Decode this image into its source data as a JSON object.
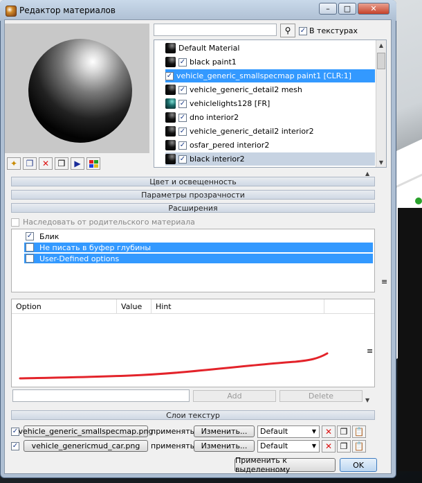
{
  "window": {
    "title": "Редактор материалов"
  },
  "titlebar": {
    "minimize": "–",
    "maximize": "□",
    "close": "✕"
  },
  "search": {
    "value": "",
    "in_textures_label": "В текстурах",
    "in_textures_checked": true
  },
  "materials": [
    {
      "name": "Default Material",
      "checked": null,
      "state": "normal",
      "swatch": "black"
    },
    {
      "name": "black paint1",
      "checked": true,
      "state": "normal",
      "swatch": "black"
    },
    {
      "name": "vehicle_generic_smallspecmap paint1 [CLR:1]",
      "checked": true,
      "state": "selected",
      "swatch": "black"
    },
    {
      "name": "vehicle_generic_detail2 mesh",
      "checked": true,
      "state": "normal",
      "swatch": "black"
    },
    {
      "name": "vehiclelights128 [FR]",
      "checked": true,
      "state": "normal",
      "swatch": "teal"
    },
    {
      "name": "dno interior2",
      "checked": true,
      "state": "normal",
      "swatch": "black"
    },
    {
      "name": "vehicle_generic_detail2 interior2",
      "checked": true,
      "state": "normal",
      "swatch": "black"
    },
    {
      "name": "osfar_pered interior2",
      "checked": true,
      "state": "normal",
      "swatch": "black"
    },
    {
      "name": "black interior2",
      "checked": true,
      "state": "light",
      "swatch": "black"
    }
  ],
  "sections": {
    "color": "Цвет и освещенность",
    "transparency": "Параметры прозрачности",
    "extensions": "Расширения",
    "texture_layers": "Слои текстур"
  },
  "inherit": {
    "label": "Наследовать от родительского материала",
    "checked": false
  },
  "options": [
    {
      "label": "Блик",
      "checked": true,
      "state": "normal"
    },
    {
      "label": "Не писать в буфер глубины",
      "checked": false,
      "state": "selected"
    },
    {
      "label": "User-Defined options",
      "checked": false,
      "state": "selected"
    }
  ],
  "table": {
    "columns": [
      "Option",
      "Value",
      "Hint"
    ]
  },
  "add_row": {
    "value": "",
    "add_label": "Add",
    "delete_label": "Delete"
  },
  "texture_layers": [
    {
      "file": "vehicle_generic_smallspecmap.png",
      "apply_label": "применять:",
      "change_label": "Изменить...",
      "mode": "Default",
      "checked": true
    },
    {
      "file": "vehicle_genericmud_car.png",
      "apply_label": "применять:",
      "change_label": "Изменить...",
      "mode": "Default",
      "checked": true
    }
  ],
  "footer": {
    "apply_selected": "Применить к выделенному",
    "ok": "OK"
  },
  "icons": {
    "title": "material-sphere-icon",
    "find": "binoculars-icon",
    "tools": [
      "new-material-icon",
      "copy-material-icon",
      "delete-icon",
      "cube-icon",
      "play-icon",
      "color-grid-icon"
    ]
  },
  "colors": {
    "selection": "#3399ff",
    "frame": "#aebfd3",
    "annotation": "#e3232a"
  }
}
